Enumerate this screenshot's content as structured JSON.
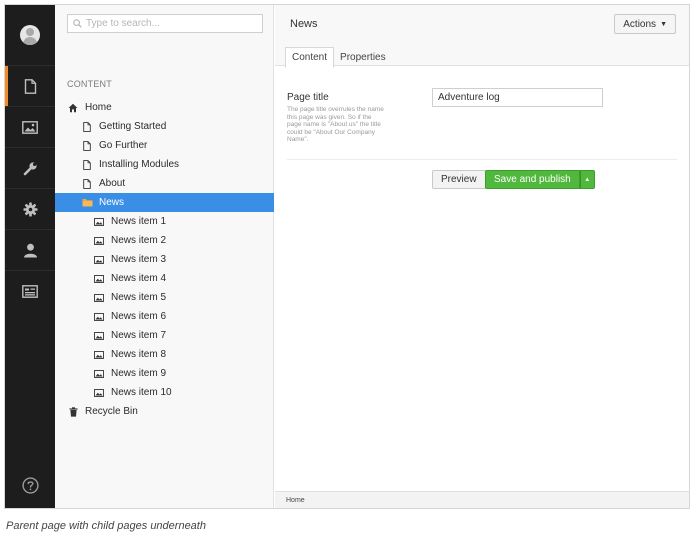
{
  "search": {
    "placeholder": "Type to search..."
  },
  "tree": {
    "heading": "CONTENT",
    "nodes": [
      {
        "label": "Home",
        "icon": "home-icon",
        "level": 0
      },
      {
        "label": "Getting Started",
        "icon": "document-icon",
        "level": 1
      },
      {
        "label": "Go Further",
        "icon": "document-icon",
        "level": 1
      },
      {
        "label": "Installing Modules",
        "icon": "document-icon",
        "level": 1
      },
      {
        "label": "About",
        "icon": "document-icon",
        "level": 1
      },
      {
        "label": "News",
        "icon": "folder-icon",
        "level": 1,
        "selected": true
      },
      {
        "label": "News item 1",
        "icon": "image-icon",
        "level": 2
      },
      {
        "label": "News item 2",
        "icon": "image-icon",
        "level": 2
      },
      {
        "label": "News item 3",
        "icon": "image-icon",
        "level": 2
      },
      {
        "label": "News item 4",
        "icon": "image-icon",
        "level": 2
      },
      {
        "label": "News item 5",
        "icon": "image-icon",
        "level": 2
      },
      {
        "label": "News item 6",
        "icon": "image-icon",
        "level": 2
      },
      {
        "label": "News item 7",
        "icon": "image-icon",
        "level": 2
      },
      {
        "label": "News item 8",
        "icon": "image-icon",
        "level": 2
      },
      {
        "label": "News item 9",
        "icon": "image-icon",
        "level": 2
      },
      {
        "label": "News item 10",
        "icon": "image-icon",
        "level": 2
      },
      {
        "label": "Recycle Bin",
        "icon": "trash-icon",
        "level": 0
      }
    ]
  },
  "rail": {
    "sections": [
      {
        "name": "content",
        "icon": "document-icon",
        "active": true
      },
      {
        "name": "media",
        "icon": "image-icon"
      },
      {
        "name": "settings",
        "icon": "wrench-icon"
      },
      {
        "name": "developer",
        "icon": "gear-icon"
      },
      {
        "name": "users",
        "icon": "user-icon"
      },
      {
        "name": "members",
        "icon": "id-card-icon"
      }
    ],
    "help_icon": "help-icon"
  },
  "main": {
    "title": "News",
    "actions_label": "Actions",
    "tabs": [
      {
        "label": "Content",
        "active": true
      },
      {
        "label": "Properties"
      }
    ],
    "field": {
      "label": "Page title",
      "description": "The page title overrules the name this page was given. So if the page name is \"About us\" the title could be \"About Our Company Name\".",
      "value": "Adventure log"
    },
    "preview_label": "Preview",
    "publish_label": "Save and publish",
    "breadcrumb": "Home"
  },
  "caption": "Parent page with child pages underneath",
  "colors": {
    "rail_bg": "#1d1d1d",
    "active_accent": "#f08b27",
    "selected_bg": "#3a8ee6",
    "publish_green": "#50b83c"
  }
}
